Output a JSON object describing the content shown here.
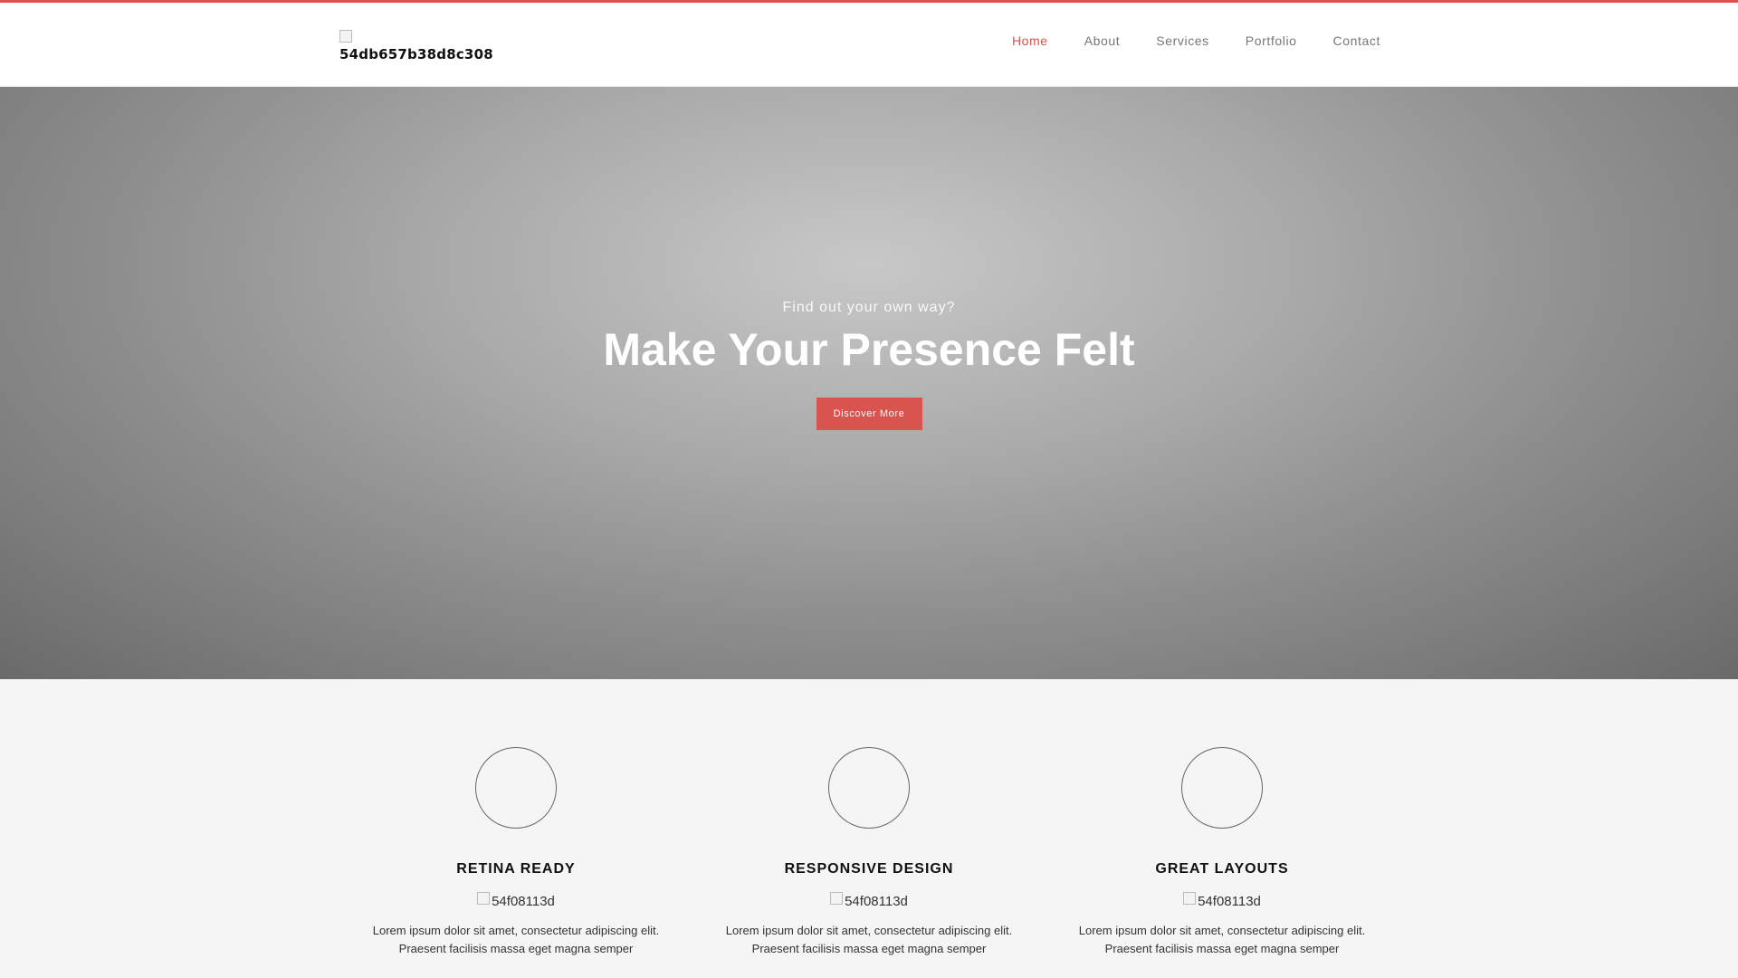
{
  "header": {
    "logo_alt": "54db657b38d8c308",
    "nav": [
      {
        "label": "Home",
        "active": true
      },
      {
        "label": "About",
        "active": false
      },
      {
        "label": "Services",
        "active": false
      },
      {
        "label": "Portfolio",
        "active": false
      },
      {
        "label": "Contact",
        "active": false
      }
    ]
  },
  "hero": {
    "subtitle": "Find out your own way?",
    "title": "Make Your Presence Felt",
    "button_label": "Discover More"
  },
  "features": [
    {
      "title": "RETINA READY",
      "image_alt": "54f08113d",
      "description": "Lorem ipsum dolor sit amet, consectetur adipiscing elit. Praesent facilisis massa eget magna semper"
    },
    {
      "title": "RESPONSIVE DESIGN",
      "image_alt": "54f08113d",
      "description": "Lorem ipsum dolor sit amet, consectetur adipiscing elit. Praesent facilisis massa eget magna semper"
    },
    {
      "title": "GREAT LAYOUTS",
      "image_alt": "54f08113d",
      "description": "Lorem ipsum dolor sit amet, consectetur adipiscing elit. Praesent facilisis massa eget magna semper"
    }
  ],
  "colors": {
    "accent": "#d9534f",
    "header_bg": "#ffffff",
    "page_bg": "#f5f5f5"
  }
}
